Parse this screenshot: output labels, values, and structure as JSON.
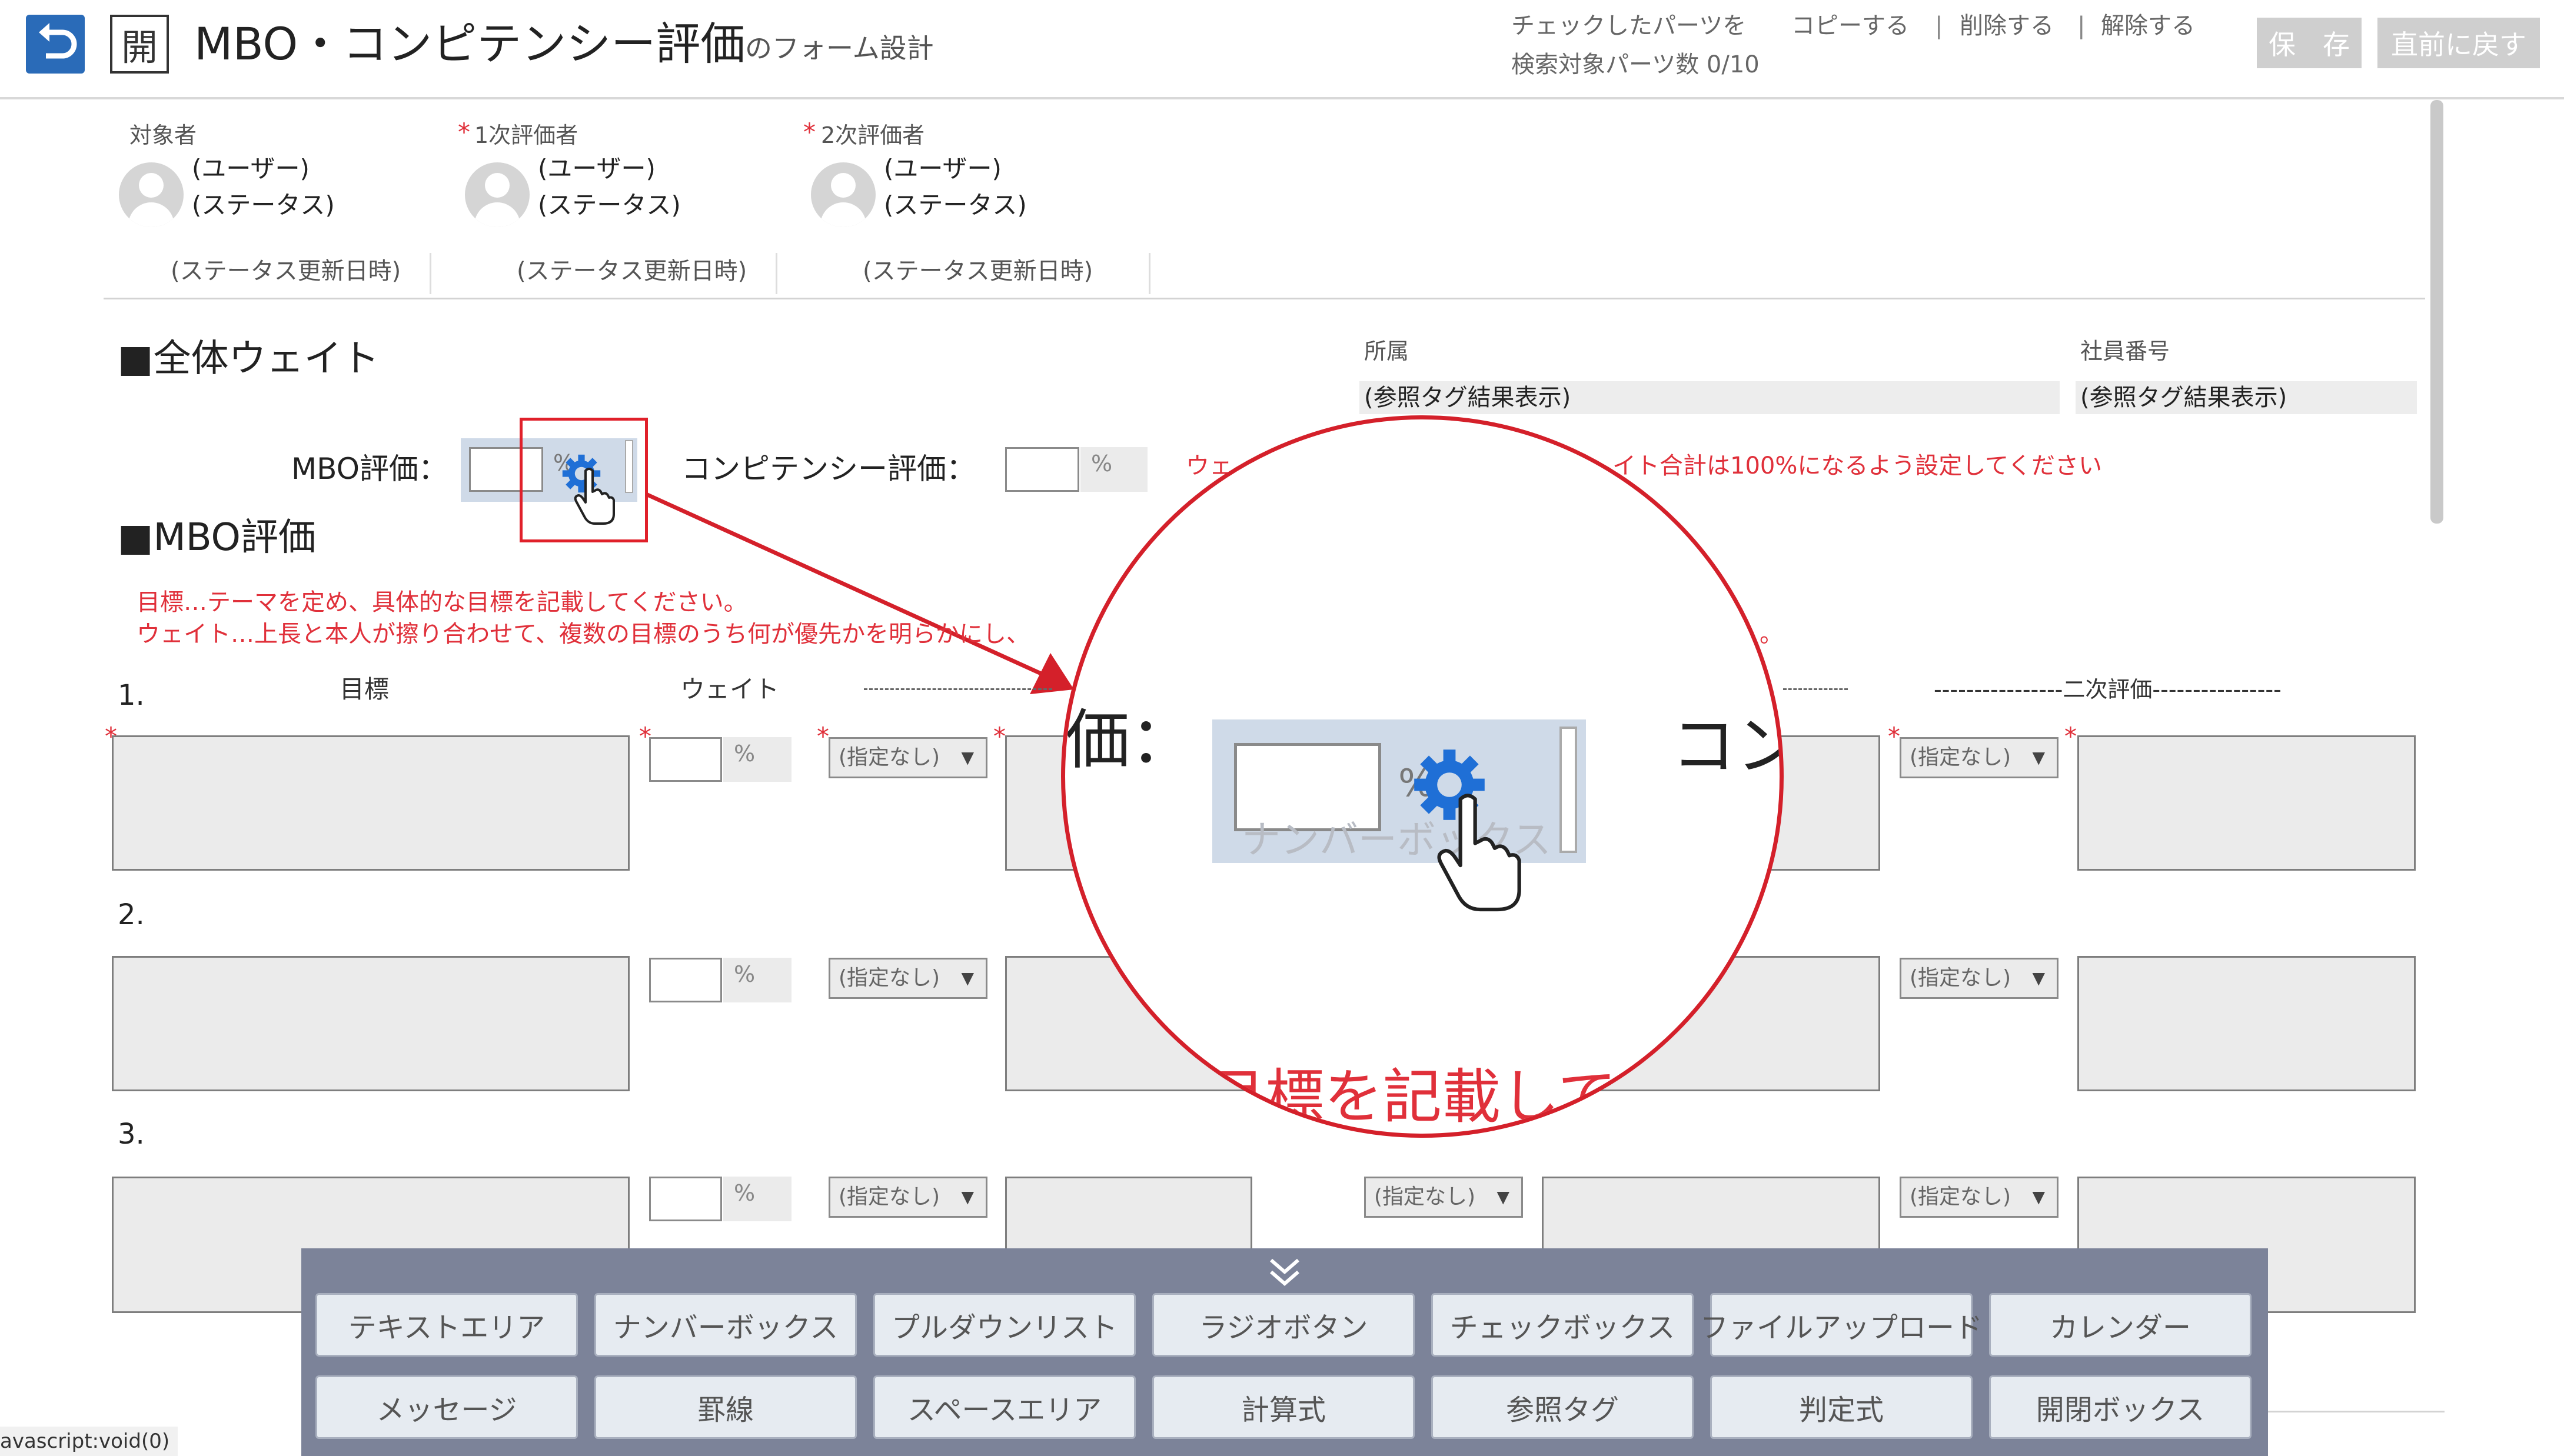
{
  "header": {
    "title": "MBO・コンピテンシー評価",
    "subtitle": "のフォーム設計",
    "open_label": "開",
    "menu_prefix": "チェックしたパーツを",
    "menu_copy": "コピーする",
    "menu_delete": "削除する",
    "menu_release": "解除する",
    "menu_sep": "|",
    "search_count": "検索対象パーツ数 0/10",
    "save_button": "保　存",
    "revert_button": "直前に戻す"
  },
  "evaluators": [
    {
      "role": "対象者",
      "required": false,
      "user": "(ユーザー)",
      "status": "(ステータス)",
      "updated": "(ステータス更新日時)"
    },
    {
      "role": "1次評価者",
      "required": true,
      "user": "(ユーザー)",
      "status": "(ステータス)",
      "updated": "(ステータス更新日時)"
    },
    {
      "role": "2次評価者",
      "required": true,
      "user": "(ユーザー)",
      "status": "(ステータス)",
      "updated": "(ステータス更新日時)"
    }
  ],
  "required_mark": "*",
  "weight_section": {
    "title": "■全体ウェイト",
    "mbo_label": "MBO評価：",
    "competency_label": "コンピテンシー評価：",
    "pct": "%",
    "ghost_label": "ナンバーボックス",
    "warning_left": "ウェ",
    "warning_right": "イト合計は100%になるよう設定してください"
  },
  "reference": {
    "affiliation_label": "所属",
    "affiliation_value": "(参照タグ結果表示)",
    "employee_label": "社員番号",
    "employee_value": "(参照タグ結果表示)"
  },
  "mbo_section": {
    "title": "■MBO評価",
    "note1": "目標…テーマを定め、具体的な目標を記載してください。",
    "note2": "ウェイト…上長と本人が擦り合わせて、複数の目標のうち何が優先かを明らかにし、",
    "note2_tail": "。",
    "col_goal": "目標",
    "col_weight": "ウェイト",
    "col_secondary": "----------------二次評価----------------",
    "rows": [
      "1.",
      "2.",
      "3."
    ],
    "select_default": "(指定なし)",
    "pct": "%"
  },
  "magnifier": {
    "left_text": "価：",
    "right_text": "コン",
    "bottom_text": "目標を記載して"
  },
  "palette": {
    "toggle_icon": "double-chevron-down-icon",
    "row1": [
      "テキストエリア",
      "ナンバーボックス",
      "プルダウンリスト",
      "ラジオボタン",
      "チェックボックス",
      "ファイルアップロード",
      "カレンダー"
    ],
    "row2": [
      "メッセージ",
      "罫線",
      "スペースエリア",
      "計算式",
      "参照タグ",
      "判定式",
      "開閉ボックス"
    ]
  },
  "status_url": "avascript:void(0)",
  "colors": {
    "accent": "#2a6bb8",
    "warning": "#e0303a",
    "palette_bg": "#7c8399",
    "highlight": "#e0202a"
  }
}
